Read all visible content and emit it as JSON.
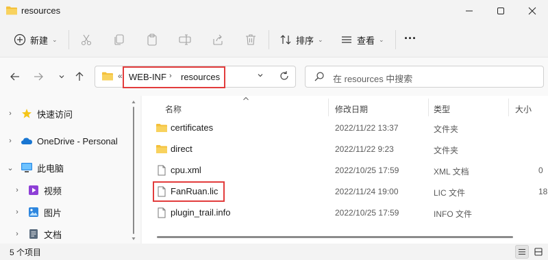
{
  "window": {
    "title": "resources"
  },
  "toolbar": {
    "new_label": "新建",
    "sort_label": "排序",
    "view_label": "查看",
    "more_label": "···"
  },
  "address": {
    "overflow": "«",
    "crumbs": [
      "WEB-INF",
      "resources"
    ],
    "separator": "›"
  },
  "search": {
    "placeholder": "在 resources 中搜索"
  },
  "nav": {
    "items": [
      {
        "label": "快速访问",
        "icon": "star-icon"
      },
      {
        "label": "OneDrive - Personal",
        "icon": "cloud-icon"
      },
      {
        "label": "此电脑",
        "icon": "computer-icon"
      },
      {
        "label": "视频",
        "icon": "video-icon"
      },
      {
        "label": "图片",
        "icon": "picture-icon"
      },
      {
        "label": "文档",
        "icon": "document-icon"
      }
    ]
  },
  "columns": {
    "name": "名称",
    "modified": "修改日期",
    "type": "类型",
    "size": "大小"
  },
  "files": [
    {
      "name": "certificates",
      "date": "2022/11/22 13:37",
      "type": "文件夹",
      "size": "",
      "kind": "folder"
    },
    {
      "name": "direct",
      "date": "2022/11/22 9:23",
      "type": "文件夹",
      "size": "",
      "kind": "folder"
    },
    {
      "name": "cpu.xml",
      "date": "2022/10/25 17:59",
      "type": "XML 文档",
      "size": "0",
      "kind": "file"
    },
    {
      "name": "FanRuan.lic",
      "date": "2022/11/24 19:00",
      "type": "LIC 文件",
      "size": "18",
      "kind": "file"
    },
    {
      "name": "plugin_trail.info",
      "date": "2022/10/25 17:59",
      "type": "INFO 文件",
      "size": "",
      "kind": "file"
    }
  ],
  "status": {
    "count": "5 个项目"
  },
  "colors": {
    "highlight": "#e23b3b",
    "folder": "#f4c03a",
    "accent": "#1a73e8"
  }
}
